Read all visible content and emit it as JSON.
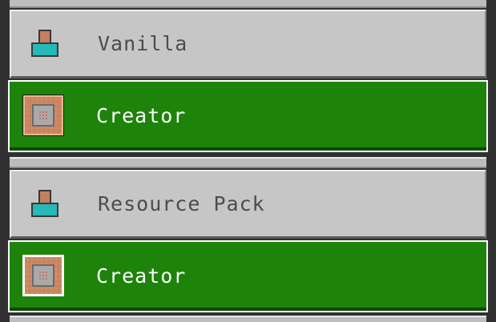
{
  "rows": [
    {
      "label": "Vanilla",
      "icon": "person-icon",
      "state": "unselected"
    },
    {
      "label": "Creator",
      "icon": "command-block-icon",
      "state": "selected"
    },
    {
      "label": "Resource Pack",
      "icon": "person-icon",
      "state": "unselected"
    },
    {
      "label": "Creator",
      "icon": "command-block-icon",
      "state": "selected"
    }
  ],
  "colors": {
    "selected_bg": "#1e830a",
    "unselected_bg": "#c6c6c6",
    "background": "#313131"
  }
}
